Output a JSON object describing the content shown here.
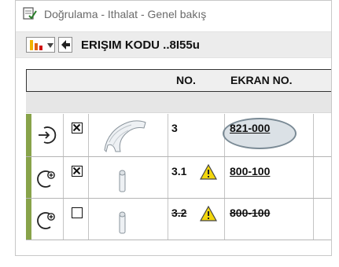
{
  "window": {
    "title": "Doğrulama - Ithalat - Genel bakış"
  },
  "toolbar": {
    "access_code": "ERIŞIM KODU ..8I55u"
  },
  "table": {
    "headers": {
      "no": "NO.",
      "screen_no": "EKRAN NO."
    },
    "rows": [
      {
        "type_icon": "arrow-into-circle-icon",
        "checked": true,
        "part": "fender-panel",
        "no": "3",
        "warning": false,
        "screen_no": "821-000",
        "strikethrough": false,
        "highlighted": true
      },
      {
        "type_icon": "add-circle-icon",
        "checked": true,
        "part": "pin",
        "no": "3.1",
        "warning": true,
        "screen_no": "800-100",
        "strikethrough": false,
        "highlighted": false
      },
      {
        "type_icon": "add-circle-icon",
        "checked": false,
        "part": "pin",
        "no": "3.2",
        "warning": true,
        "screen_no": "800-100",
        "strikethrough": true,
        "highlighted": false
      }
    ]
  },
  "colors": {
    "row_status_bar": "#88a34a",
    "warning": "#f2d60c"
  }
}
